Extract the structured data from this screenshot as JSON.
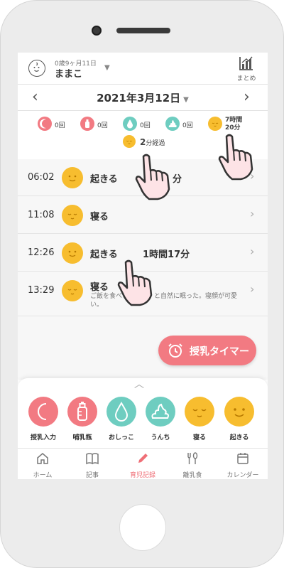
{
  "header": {
    "age": "0歳9ヶ月11日",
    "child_name": "ままこ",
    "summary_label": "まとめ"
  },
  "date_nav": {
    "date": "2021年3月12日",
    "caret": "▼",
    "prev": "‹",
    "next": "›"
  },
  "counts": {
    "feeding": "0回",
    "bottle": "0回",
    "pee": "0回",
    "poop": "0回",
    "sleep_hours": "7時間",
    "sleep_minutes": "20分",
    "elapsed_value": "2",
    "elapsed_unit": "分経過"
  },
  "timeline": [
    {
      "time": "06:02",
      "label": "起きる",
      "duration": "分",
      "memo": ""
    },
    {
      "time": "11:08",
      "label": "寝る",
      "duration": "",
      "memo": ""
    },
    {
      "time": "12:26",
      "label": "起きる",
      "duration": "1時間17分",
      "memo": ""
    },
    {
      "time": "13:29",
      "label": "寝る",
      "duration": "",
      "memo": "ご飯を食べ　　　　　と自然に眠った。寝顔が可愛い。"
    }
  ],
  "timer_button": {
    "label": "授乳タイマー"
  },
  "record_buttons": [
    {
      "label": "授乳入力",
      "icon": "moon-icon",
      "color": "#f27a82"
    },
    {
      "label": "哺乳瓶",
      "icon": "bottle-icon",
      "color": "#f27a82"
    },
    {
      "label": "おしっこ",
      "icon": "drop-icon",
      "color": "#6ecdc0"
    },
    {
      "label": "うんち",
      "icon": "poop-icon",
      "color": "#6ecdc0"
    },
    {
      "label": "寝る",
      "icon": "sleeping-face-icon",
      "color": "#f7bd2f"
    },
    {
      "label": "起きる",
      "icon": "awake-face-icon",
      "color": "#f7bd2f"
    }
  ],
  "tabs": [
    {
      "label": "ホーム",
      "icon": "home-icon"
    },
    {
      "label": "記事",
      "icon": "book-icon"
    },
    {
      "label": "育児記録",
      "icon": "pencil-icon"
    },
    {
      "label": "離乳食",
      "icon": "utensils-icon"
    },
    {
      "label": "カレンダー",
      "icon": "calendar-icon"
    }
  ],
  "colors": {
    "pink": "#f27a82",
    "teal": "#6ecdc0",
    "yellow": "#f7bd2f",
    "active_tab": "#ef6f77"
  }
}
